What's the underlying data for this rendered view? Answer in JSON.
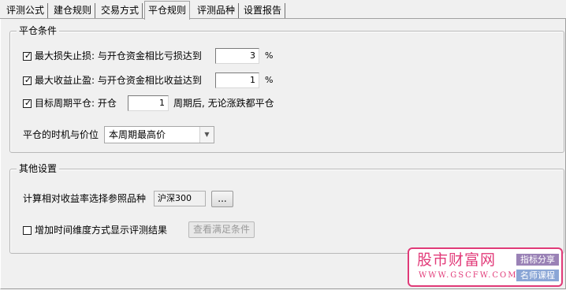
{
  "tabs": [
    {
      "label": "评测公式"
    },
    {
      "label": "建仓规则"
    },
    {
      "label": "交易方式"
    },
    {
      "label": "平仓规则",
      "active": true
    },
    {
      "label": "评测品种"
    },
    {
      "label": "设置报告"
    }
  ],
  "close_group": {
    "title": "平仓条件",
    "stop_loss": {
      "checked": true,
      "label": "最大损失止损: 与开仓资金相比亏损达到",
      "value": "3",
      "unit": "%"
    },
    "take_profit": {
      "checked": true,
      "label": "最大收益止盈: 与开仓资金相比收益达到",
      "value": "1",
      "unit": "%"
    },
    "period_close": {
      "checked": true,
      "label": "目标周期平仓: 开仓",
      "value": "1",
      "suffix": "周期后, 无论涨跌都平仓"
    },
    "timing_label": "平仓的时机与价位",
    "timing_select": {
      "value": "本周期最高价"
    }
  },
  "other_group": {
    "title": "其他设置",
    "reference_label": "计算相对收益率选择参照品种",
    "reference_value": "沪深300",
    "browse_label": "...",
    "time_dimension": {
      "checked": false,
      "label": "增加时间维度方式显示评测结果"
    },
    "view_button": "查看满足条件"
  },
  "watermark": {
    "title": "股市财富网",
    "url": "WWW.GSCFW.COM",
    "tag1": "指标分享",
    "tag2": "名师课程"
  },
  "colors": {
    "watermark_accent": "#e23c7a"
  }
}
